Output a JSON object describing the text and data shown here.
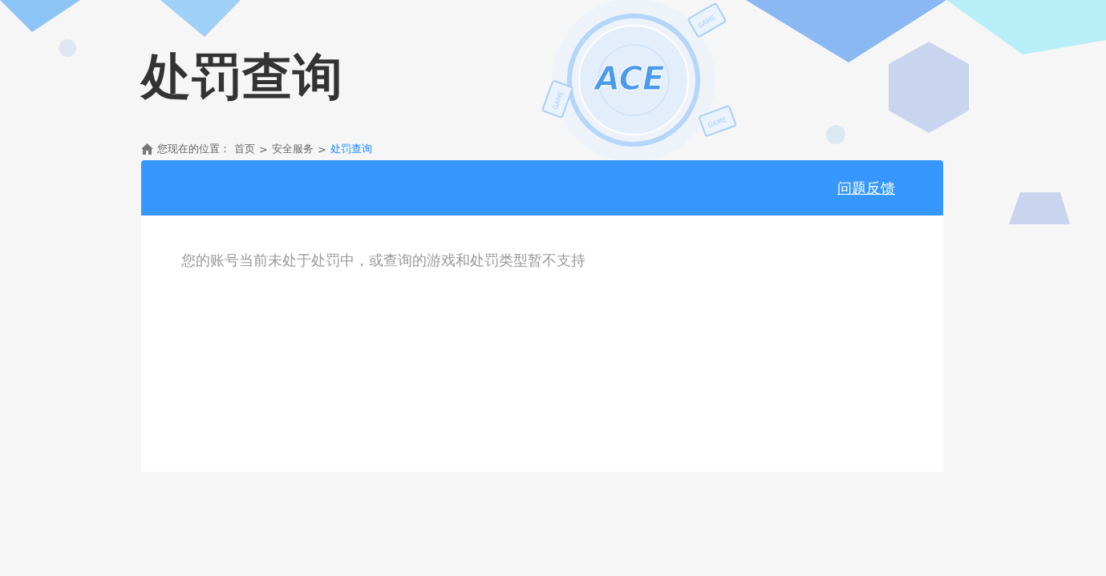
{
  "page_title": "处罚查询",
  "logo": {
    "text": "ACE",
    "device_labels": [
      "GAME",
      "GAME",
      "GAME"
    ]
  },
  "breadcrumb": {
    "prefix": "您现在的位置：",
    "items": [
      {
        "label": "首页",
        "selected": false
      },
      {
        "label": "安全服务",
        "selected": false
      },
      {
        "label": "处罚查询",
        "selected": true
      }
    ],
    "separator": ">"
  },
  "panel": {
    "feedback_link": "问题反馈",
    "message": "您的账号当前未处于处罚中，或查询的游戏和处罚类型暂不支持"
  }
}
